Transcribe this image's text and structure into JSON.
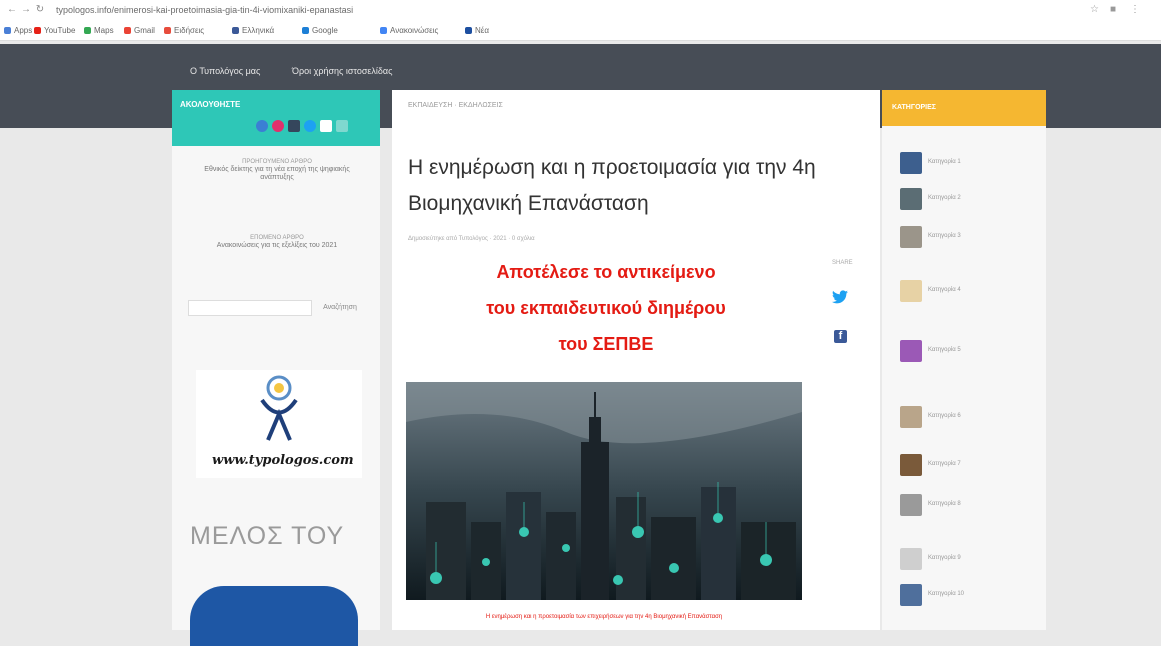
{
  "browser": {
    "address": "typologos.info/enimerosi-kai-proetoimasia-gia-tin-4i-viomixaniki-epanastasi",
    "bookmarks": [
      "Apps",
      "YouTube",
      "Maps",
      "Gmail",
      "Ειδήσεις",
      "Ελληνικά",
      "Google",
      "Ανακοινώσεις",
      "Νέα"
    ]
  },
  "site_nav": {
    "links": [
      "Ο Τυπολόγος μας",
      "Όροι χρήσης ιστοσελίδας"
    ]
  },
  "left_sidebar": {
    "follow_title": "ΑΚΟΛΟΥΘΗΣΤΕ",
    "posts": [
      {
        "kicker": "ΠΡΟΗΓΟΥΜΕΝΟ ΑΡΘΡΟ",
        "title": "Εθνικός δείκτης για τη νέα εποχή της ψηφιακής ανάπτυξης"
      },
      {
        "kicker": "ΕΠΟΜΕΝΟ ΑΡΘΡΟ",
        "title": "Ανακοινώσεις για τις εξελίξεις του 2021"
      }
    ],
    "search_button": "Αναζήτηση",
    "logo_text": "www.typologos.com",
    "member_text": "ΜΕΛΟΣ ΤΟΥ"
  },
  "article": {
    "breadcrumb": "ΕΚΠΑΙΔΕΥΣΗ · ΕΚΔΗΛΩΣΕΙΣ",
    "title": "Η ενημέρωση και η προετοιμασία για την 4η Βιομηχανική Επανάσταση",
    "meta": "Δημοσιεύτηκε από Τυπολόγος · 2021 · 0 σχόλια",
    "promo_lines": [
      "Αποτέλεσε το αντικείμενο",
      "του εκπαιδευτικού διημέρου",
      "του ΣΕΠΒΕ"
    ],
    "share_label": "SHARE",
    "caption": "Η ενημέρωση και η προετοιμασία των επιχειρήσεων για την 4η Βιομηχανική Επανάσταση"
  },
  "right_sidebar": {
    "title": "ΚΑΤΗΓΟΡΙΕΣ",
    "categories": [
      {
        "label": "Κατηγορία 1",
        "color": "#3d5f8e"
      },
      {
        "label": "Κατηγορία 2",
        "color": "#5b6d74"
      },
      {
        "label": "Κατηγορία 3",
        "color": "#9b958a"
      },
      {
        "label": "Κατηγορία 4",
        "color": "#e7d2a5"
      },
      {
        "label": "Κατηγορία 5",
        "color": "#9b59b6"
      },
      {
        "label": "Κατηγορία 6",
        "color": "#b9a58a"
      },
      {
        "label": "Κατηγορία 7",
        "color": "#7a5a3a"
      },
      {
        "label": "Κατηγορία 8",
        "color": "#9a9a9a"
      },
      {
        "label": "Κατηγορία 9",
        "color": "#cfcfcf"
      },
      {
        "label": "Κατηγορία 10",
        "color": "#4f6f9c"
      }
    ]
  },
  "colors": {
    "header": "#474d56",
    "teal": "#2ec7b7",
    "yellow": "#f5b731",
    "red": "#e41b13"
  }
}
